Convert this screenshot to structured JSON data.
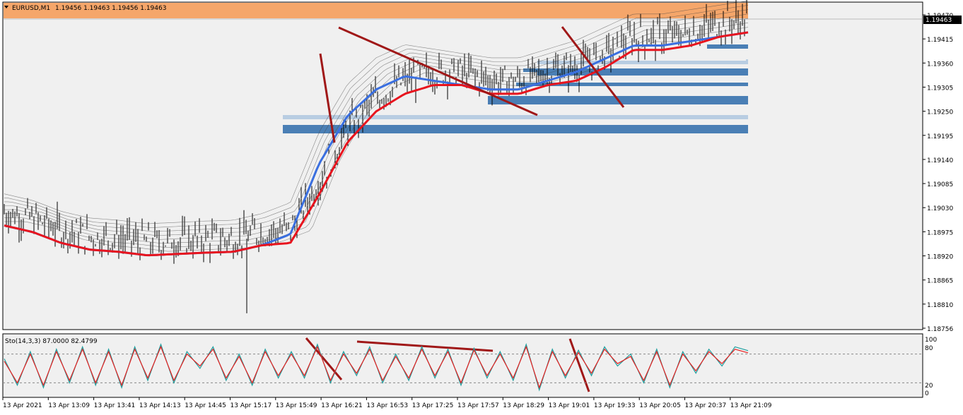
{
  "header": {
    "symbol": "EURUSD,M1",
    "ohlc": "1.19456 1.19463 1.19456 1.19463",
    "current_price": "1.19463"
  },
  "oscillator": {
    "label": "Sto(14,3,3) 87.0000 82.4799",
    "levels": [
      "100",
      "80",
      "20",
      "0"
    ]
  },
  "colors": {
    "background": "#f0f0f0",
    "candle": "#000000",
    "ema_slow": "#e8141e",
    "ema_mid": "#3a6fe0",
    "trendline": "#a01818",
    "zone_dark": "#4a7fb5",
    "zone_light": "#b8cde2",
    "top_band": "#f5a66a",
    "stoch_main": "#20a0a0",
    "stoch_signal": "#e82020"
  },
  "chart_data": {
    "type": "line",
    "title": "EURUSD,M1",
    "ylim": [
      1.18756,
      1.1947
    ],
    "y_ticks": [
      "1.19470",
      "1.19415",
      "1.19360",
      "1.19305",
      "1.19250",
      "1.19195",
      "1.19140",
      "1.19085",
      "1.19030",
      "1.18975",
      "1.18920",
      "1.18865",
      "1.18810",
      "1.18756"
    ],
    "x_ticks": [
      "13 Apr 2021",
      "13 Apr 13:09",
      "13 Apr 13:41",
      "13 Apr 14:13",
      "13 Apr 14:45",
      "13 Apr 15:17",
      "13 Apr 15:49",
      "13 Apr 16:21",
      "13 Apr 16:53",
      "13 Apr 17:25",
      "13 Apr 17:57",
      "13 Apr 18:29",
      "13 Apr 19:01",
      "13 Apr 19:33",
      "13 Apr 20:05",
      "13 Apr 20:37",
      "13 Apr 21:09"
    ],
    "series": [
      {
        "values": [
          1.1899,
          1.18975,
          1.1895,
          1.18935,
          1.1893,
          1.18922,
          1.18925,
          1.18928,
          1.1893,
          1.18945,
          1.1895,
          1.1906,
          1.1918,
          1.1925,
          1.1929,
          1.1931,
          1.1931,
          1.1929,
          1.1929,
          1.1931,
          1.1932,
          1.1935,
          1.1939,
          1.1939,
          1.194,
          1.1942,
          1.1943
        ]
      },
      {
        "values": [
          1.1899,
          1.18975,
          1.1895,
          1.18935,
          1.1893,
          1.18922,
          1.18925,
          1.18928,
          1.1893,
          1.18945,
          1.1897,
          1.1913,
          1.1924,
          1.193,
          1.1933,
          1.1932,
          1.1931,
          1.193,
          1.193,
          1.1932,
          1.1934,
          1.1937,
          1.194,
          1.194,
          1.1941,
          1.1942,
          1.1943
        ]
      }
    ],
    "stochastic": {
      "main": [
        70,
        15,
        85,
        10,
        90,
        20,
        95,
        15,
        90,
        10,
        95,
        25,
        100,
        20,
        85,
        50,
        95,
        25,
        80,
        15,
        90,
        30,
        85,
        30,
        100,
        20,
        85,
        35,
        95,
        20,
        80,
        25,
        95,
        30,
        90,
        15,
        92,
        30,
        85,
        25,
        100,
        5,
        90,
        30,
        88,
        35,
        95,
        55,
        80,
        20,
        90,
        10,
        85,
        40,
        90,
        55,
        95,
        87
      ],
      "signal": [
        65,
        20,
        80,
        15,
        85,
        25,
        90,
        20,
        85,
        15,
        90,
        30,
        95,
        25,
        80,
        55,
        90,
        30,
        75,
        20,
        85,
        35,
        80,
        35,
        95,
        25,
        80,
        40,
        90,
        25,
        75,
        30,
        90,
        35,
        85,
        20,
        88,
        35,
        80,
        30,
        95,
        10,
        85,
        35,
        83,
        40,
        90,
        60,
        75,
        25,
        85,
        15,
        80,
        45,
        85,
        60,
        90,
        82.48
      ]
    }
  }
}
